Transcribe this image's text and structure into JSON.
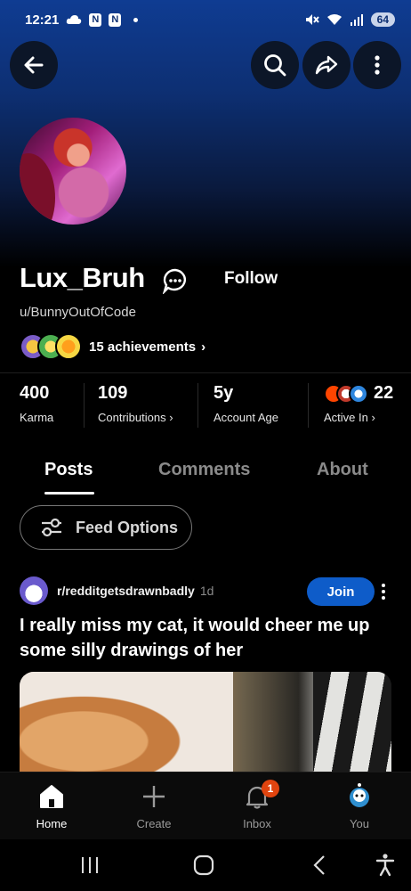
{
  "status_bar": {
    "time": "12:21",
    "battery": "64"
  },
  "profile": {
    "username": "Lux_Bruh",
    "handle": "u/BunnyOutOfCode",
    "follow_label": "Follow",
    "achievements_label": "15 achievements",
    "achievements_chevron": "›"
  },
  "stats": [
    {
      "value": "400",
      "label": "Karma"
    },
    {
      "value": "109",
      "label": "Contributions ›"
    },
    {
      "value": "5y",
      "label": "Account Age"
    },
    {
      "value": "22",
      "label": "Active In ›"
    }
  ],
  "tabs": [
    {
      "label": "Posts",
      "active": true
    },
    {
      "label": "Comments",
      "active": false
    },
    {
      "label": "About",
      "active": false
    }
  ],
  "feed_options_label": "Feed Options",
  "post": {
    "subreddit": "r/redditgetsdrawnbadly",
    "age": "1d",
    "join_label": "Join",
    "title": "I really miss my cat, it would cheer me up some silly drawings of her"
  },
  "bottom_nav": [
    {
      "label": "Home",
      "icon": "home-icon",
      "active": true
    },
    {
      "label": "Create",
      "icon": "plus-icon",
      "active": false
    },
    {
      "label": "Inbox",
      "icon": "bell-icon",
      "active": false,
      "badge": "1"
    },
    {
      "label": "You",
      "icon": "user-avatar-icon",
      "active": false
    }
  ],
  "colors": {
    "header_gradient_top": "#0f3c92",
    "join_button": "#0e5cc9",
    "inbox_badge": "#e0440f"
  }
}
